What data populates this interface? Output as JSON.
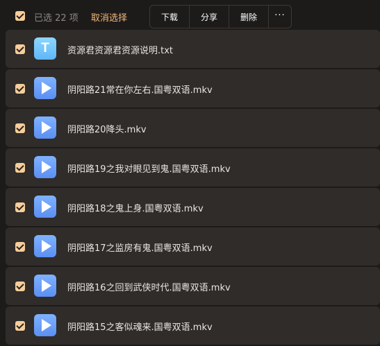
{
  "toolbar": {
    "selected_text": "已选 22 项",
    "cancel_label": "取消选择",
    "download_label": "下载",
    "share_label": "分享",
    "delete_label": "删除",
    "more_label": "···"
  },
  "files": [
    {
      "name": "资源君资源君资源说明.txt",
      "icon": "text-file-icon",
      "icon_glyph": "T"
    },
    {
      "name": "阴阳路21常在你左右.国粤双语.mkv",
      "icon": "video-file-icon"
    },
    {
      "name": "阴阳路20降头.mkv",
      "icon": "video-file-icon"
    },
    {
      "name": "阴阳路19之我对眼见到鬼.国粤双语.mkv",
      "icon": "video-file-icon"
    },
    {
      "name": "阴阳路18之鬼上身.国粤双语.mkv",
      "icon": "video-file-icon"
    },
    {
      "name": "阴阳路17之监房有鬼.国粤双语.mkv",
      "icon": "video-file-icon"
    },
    {
      "name": "阴阳路16之回到武侠时代.国粤双语.mkv",
      "icon": "video-file-icon"
    },
    {
      "name": "阴阳路15之客似魂来.国粤双语.mkv",
      "icon": "video-file-icon"
    }
  ],
  "colors": {
    "accent": "#f3b877",
    "checkbox": "#f6ce9b",
    "row_bg": "#2f2c2a",
    "page_bg": "#1d1b1a"
  }
}
